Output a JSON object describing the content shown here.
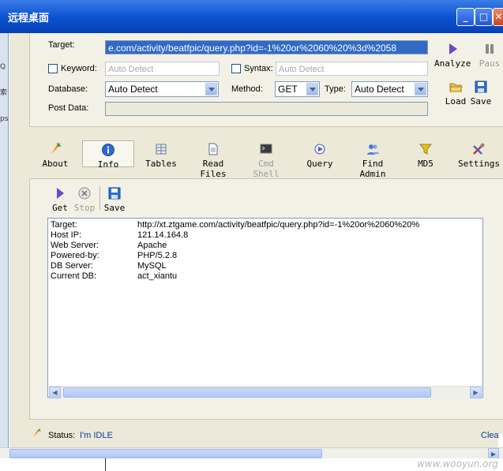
{
  "window": {
    "title": "远程桌面",
    "controls": [
      "minimize",
      "maximize",
      "close"
    ]
  },
  "left_edge_glyphs": [
    "Q",
    "索",
    "ps"
  ],
  "form": {
    "target_label": "Target:",
    "target_value": "e.com/activity/beatfpic/query.php?id=-1%20or%2060%20%3d%2058",
    "keyword_label": "Keyword:",
    "keyword_placeholder": "Auto Detect",
    "syntax_label": "Syntax:",
    "syntax_placeholder": "Auto Detect",
    "database_label": "Database:",
    "database_value": "Auto Detect",
    "method_label": "Method:",
    "method_value": "GET",
    "type_label": "Type:",
    "type_value": "Auto Detect",
    "postdata_label": "Post Data:"
  },
  "side_buttons": {
    "analyze": "Analyze",
    "pause": "Paus",
    "load": "Load",
    "save": "Save"
  },
  "toolbar": [
    {
      "label": "About",
      "icon": "carrot-icon",
      "enabled": true
    },
    {
      "label": "Info",
      "icon": "info-icon",
      "enabled": true,
      "active": true
    },
    {
      "label": "Tables",
      "icon": "table-icon",
      "enabled": true
    },
    {
      "label": "Read Files",
      "icon": "document-icon",
      "enabled": true
    },
    {
      "label": "Cmd Shell",
      "icon": "terminal-icon",
      "enabled": false
    },
    {
      "label": "Query",
      "icon": "query-icon",
      "enabled": true
    },
    {
      "label": "Find Admin",
      "icon": "users-icon",
      "enabled": true
    },
    {
      "label": "MD5",
      "icon": "funnel-icon",
      "enabled": true
    },
    {
      "label": "Settings",
      "icon": "tools-icon",
      "enabled": true
    }
  ],
  "info_actions": {
    "get": "Get",
    "stop": "Stop",
    "save": "Save"
  },
  "info_rows": [
    {
      "key": "Target:",
      "value": "http://xt.ztgame.com/activity/beatfpic/query.php?id=-1%20or%2060%20%"
    },
    {
      "key": "Host IP:",
      "value": "121.14.164.8"
    },
    {
      "key": "Web Server:",
      "value": "Apache"
    },
    {
      "key": "Powered-by:",
      "value": "PHP/5.2.8"
    },
    {
      "key": "DB Server:",
      "value": "MySQL"
    },
    {
      "key": "Current DB:",
      "value": "act_xiantu"
    }
  ],
  "status": {
    "label": "Status:",
    "value": "I'm IDLE",
    "clear": "Clea"
  },
  "watermark": "www.wooyun.org",
  "colors": {
    "titlebar": "#0a50d0",
    "selection": "#316ac5",
    "status_value": "#0a3aa0"
  }
}
